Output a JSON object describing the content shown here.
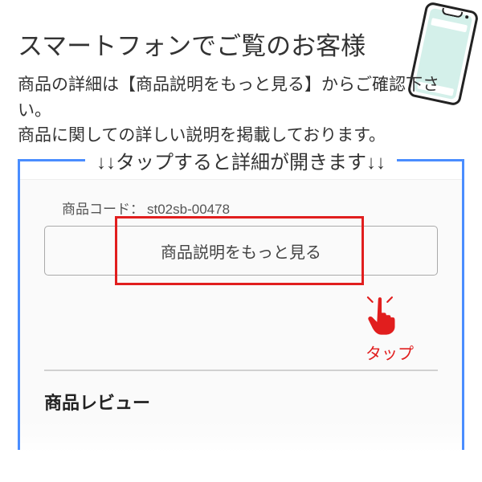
{
  "heading": "スマートフォンでご覧のお客様",
  "lead_line1": "商品の詳細は【商品説明をもっと見る】からご確認下さい。",
  "lead_line2": "商品に関しての詳しい説明を掲載しております。",
  "tap_instruction": "↓↓タップすると詳細が開きます↓↓",
  "product_code_label": "商品コード：",
  "product_code_value": "st02sb-00478",
  "detail_button_label": "商品説明をもっと見る",
  "tap_label": "タップ",
  "review_heading": "商品レビュー"
}
